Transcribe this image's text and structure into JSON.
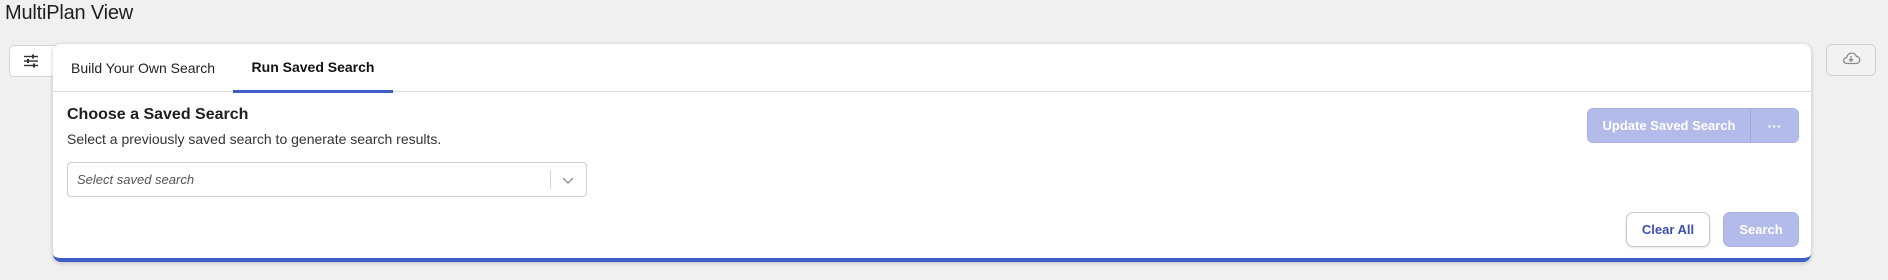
{
  "page": {
    "title": "MultiPlan View"
  },
  "toolbar": {
    "filter_icon": "sliders-icon",
    "cloud_icon": "cloud-download-icon"
  },
  "tabs": [
    {
      "label": "Build Your Own Search",
      "active": false
    },
    {
      "label": "Run Saved Search",
      "active": true
    }
  ],
  "saved_search": {
    "title": "Choose a Saved Search",
    "description": "Select a previously saved search to generate search results.",
    "select": {
      "placeholder": "Select saved search",
      "value": ""
    }
  },
  "actions": {
    "update_label": "Update Saved Search",
    "more_label": "···",
    "clear_label": "Clear All",
    "search_label": "Search"
  },
  "colors": {
    "accent": "#3d5ec9",
    "disabled_button": "#b3bbea",
    "link_text": "#3d4fb0"
  }
}
